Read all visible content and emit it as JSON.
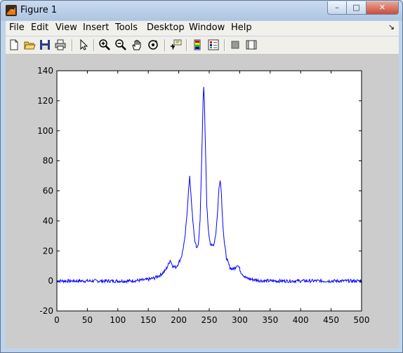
{
  "window": {
    "title": "Figure 1",
    "minimize_glyph": "–",
    "maximize_glyph": "□",
    "close_glyph": "✕"
  },
  "menubar": {
    "items": [
      "File",
      "Edit",
      "View",
      "Insert",
      "Tools",
      "Desktop",
      "Window",
      "Help"
    ],
    "dock_arrow": "↘"
  },
  "toolbar": {
    "tools": [
      "new-figure-icon",
      "open-file-icon",
      "save-icon",
      "print-icon",
      "pointer-icon",
      "zoom-in-icon",
      "zoom-out-icon",
      "pan-hand-icon",
      "rotate-3d-icon",
      "data-cursor-icon",
      "insert-colorbar-icon",
      "insert-legend-icon",
      "hide-plot-tools-icon",
      "show-plot-tools-icon"
    ]
  },
  "colors": {
    "line": "#0000ff",
    "axes_background": "#ffffff",
    "figure_background": "#cccccc"
  },
  "chart_data": {
    "type": "line",
    "title": "",
    "xlabel": "",
    "ylabel": "",
    "xlim": [
      0,
      500
    ],
    "ylim": [
      -20,
      140
    ],
    "xticks": [
      0,
      50,
      100,
      150,
      200,
      250,
      300,
      350,
      400,
      450,
      500
    ],
    "yticks": [
      -20,
      0,
      20,
      40,
      60,
      80,
      100,
      120,
      140
    ],
    "grid": false,
    "legend": "none",
    "series": [
      {
        "x": [
          0,
          20,
          40,
          60,
          80,
          100,
          120,
          140,
          150,
          160,
          170,
          178,
          183,
          186,
          190,
          195,
          200,
          205,
          210,
          213,
          216,
          218,
          220,
          223,
          226,
          229,
          232,
          235,
          237,
          239,
          240,
          241,
          242,
          244,
          246,
          249,
          252,
          255,
          258,
          261,
          264,
          266,
          268,
          270,
          272,
          275,
          278,
          281,
          284,
          287,
          290,
          293,
          296,
          299,
          302,
          306,
          310,
          320,
          330,
          340,
          350,
          360,
          370,
          380,
          400,
          420,
          440,
          460,
          480,
          500
        ],
        "y": [
          0,
          0,
          0,
          0,
          0,
          0,
          0,
          0.5,
          1,
          2,
          4,
          7,
          11,
          14,
          10,
          9,
          12,
          17,
          28,
          42,
          60,
          69,
          58,
          40,
          28,
          22,
          24,
          40,
          70,
          105,
          122,
          130,
          120,
          85,
          50,
          32,
          25,
          23,
          25,
          32,
          48,
          62,
          68,
          58,
          40,
          25,
          16,
          12,
          9,
          8,
          8,
          9,
          11,
          9,
          6,
          4,
          2,
          1,
          0.5,
          0,
          0,
          0,
          0,
          0,
          0,
          0,
          0,
          0,
          0,
          0
        ]
      }
    ]
  }
}
